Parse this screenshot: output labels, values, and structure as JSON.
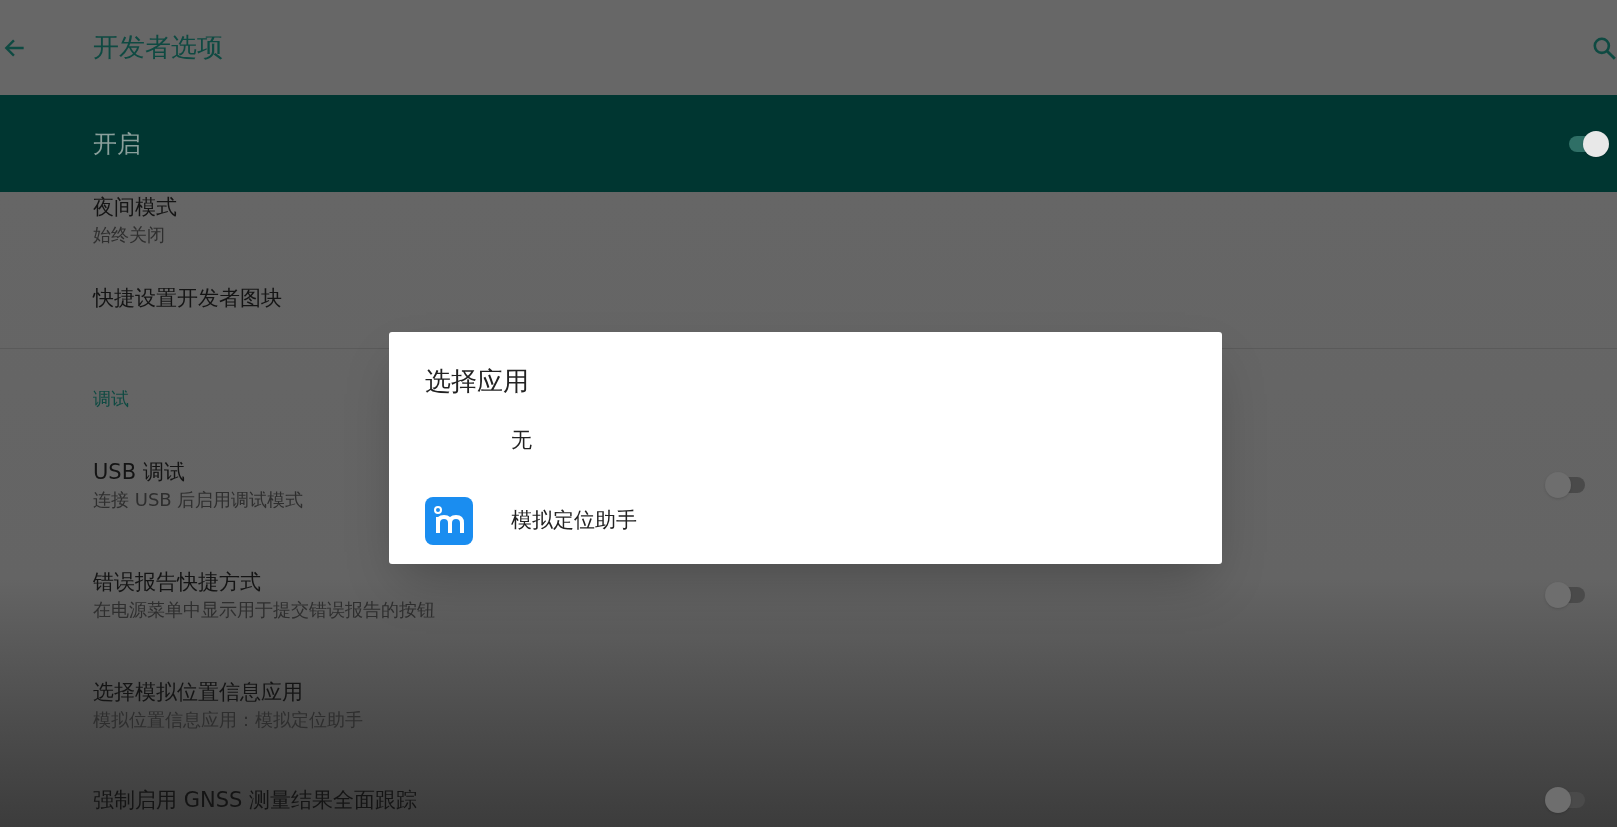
{
  "app_bar": {
    "title": "开发者选项"
  },
  "master_switch": {
    "label": "开启",
    "on": true
  },
  "settings": [
    {
      "kind": "plain",
      "title": "夜间模式",
      "summary": "始终关闭"
    },
    {
      "kind": "plain",
      "title": "快捷设置开发者图块"
    },
    {
      "kind": "divider"
    },
    {
      "kind": "header",
      "title": "调试"
    },
    {
      "kind": "toggle",
      "title": "USB 调试",
      "summary": "连接 USB 后启用调试模式",
      "on": false
    },
    {
      "kind": "toggle",
      "title": "错误报告快捷方式",
      "summary": "在电源菜单中显示用于提交错误报告的按钮",
      "on": false
    },
    {
      "kind": "plain",
      "title": "选择模拟位置信息应用",
      "summary": "模拟位置信息应用：模拟定位助手"
    },
    {
      "kind": "toggle",
      "title": "强制启用 GNSS 测量结果全面跟踪",
      "on": false
    }
  ],
  "dialog": {
    "title": "选择应用",
    "options": [
      {
        "label": "无",
        "has_icon": false
      },
      {
        "label": "模拟定位助手",
        "has_icon": true
      }
    ]
  }
}
